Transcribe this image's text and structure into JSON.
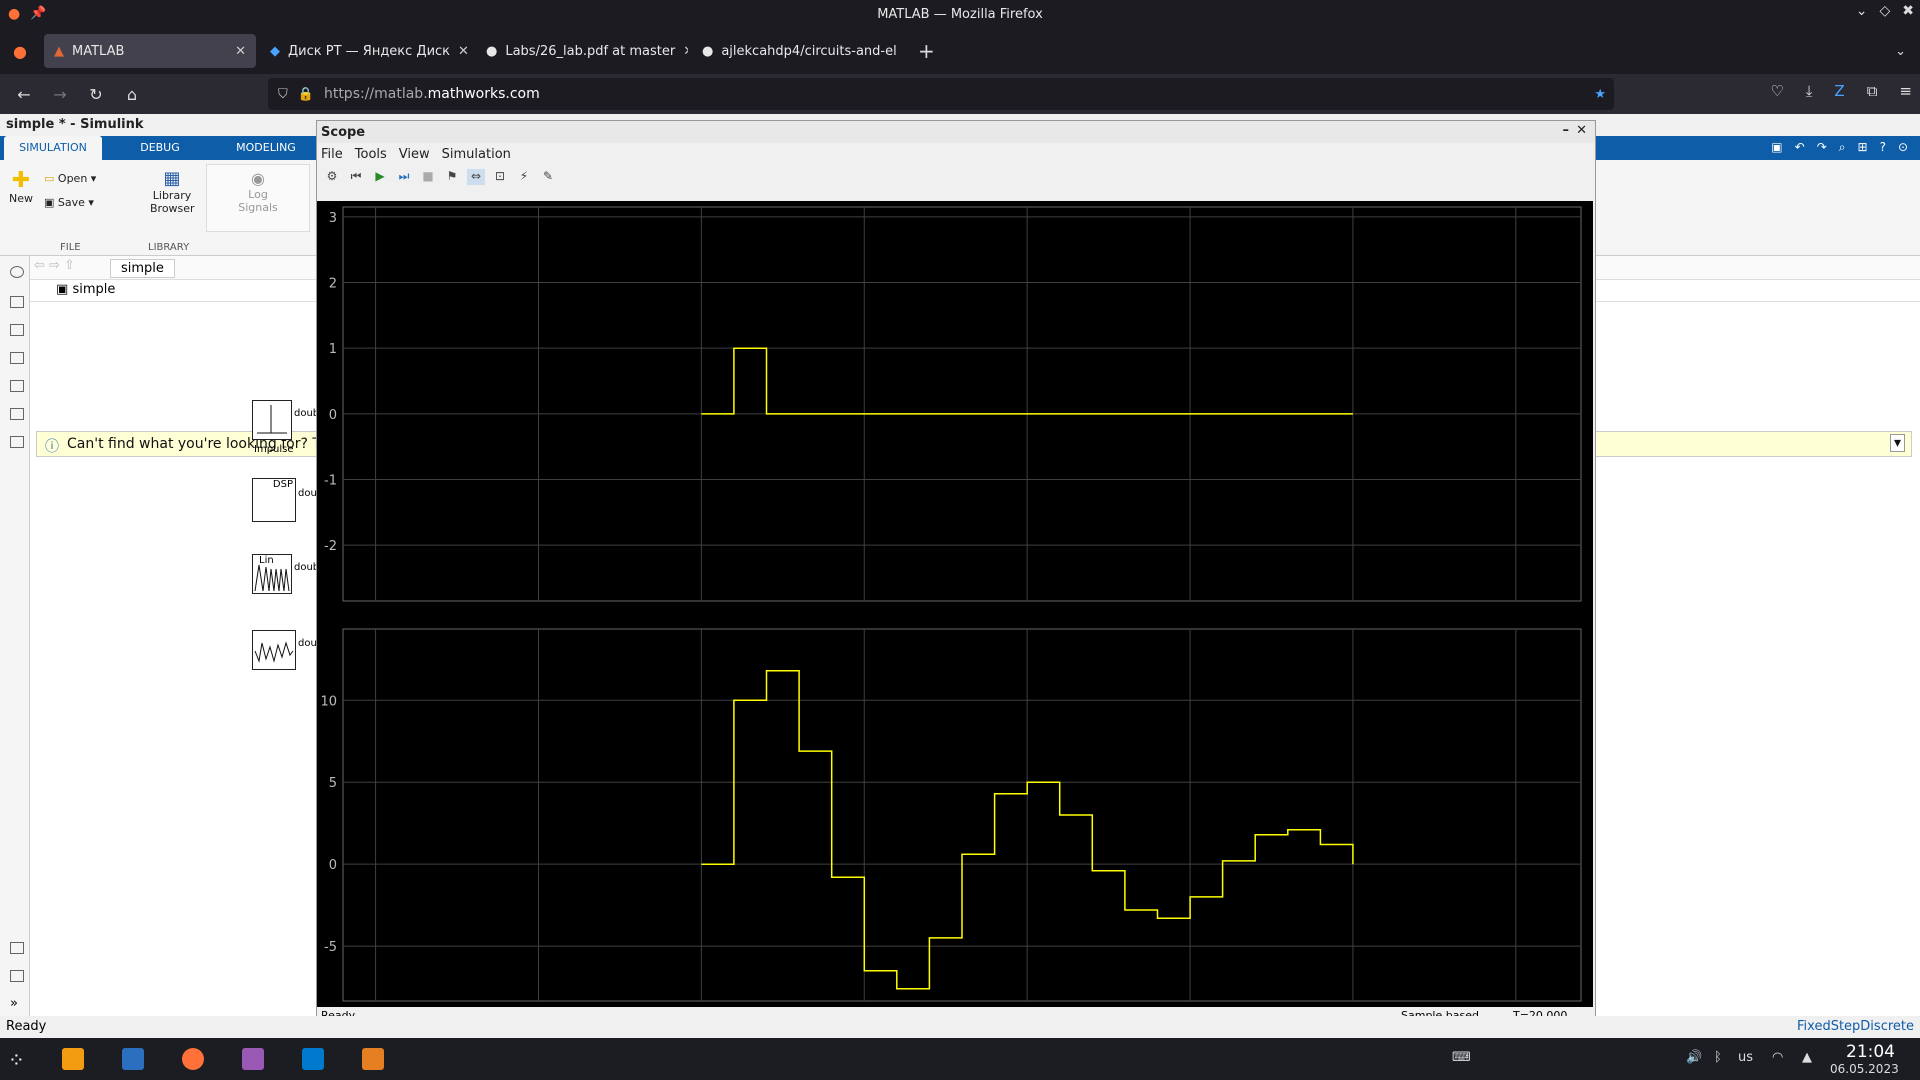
{
  "window": {
    "title": "MATLAB — Mozilla Firefox"
  },
  "tabs": [
    {
      "label": "MATLAB"
    },
    {
      "label": "Диск РТ — Яндекс Диск"
    },
    {
      "label": "Labs/26_lab.pdf at master"
    },
    {
      "label": "ajlekcahdp4/circuits-and-el"
    }
  ],
  "url": {
    "prefix": "https://matlab.",
    "domain": "mathworks.com"
  },
  "simulink": {
    "title": "simple * - Simulink",
    "ribbon_tabs": [
      "SIMULATION",
      "DEBUG",
      "MODELING"
    ],
    "file_group": {
      "new": "New",
      "open": "Open",
      "save": "Save",
      "label": "FILE"
    },
    "library_group": {
      "library_browser_line1": "Library",
      "library_browser_line2": "Browser",
      "label": "LIBRARY"
    },
    "log_signals_line1": "Log",
    "log_signals_line2": "Signals",
    "breadcrumb": "simple",
    "address": "simple",
    "info_bar": "Can't find what you're looking for? T",
    "blocks": [
      {
        "label": "Impulse",
        "port": "doub"
      },
      {
        "label": "DSP",
        "port": "dou"
      },
      {
        "label": "Lin",
        "port": "doub"
      },
      {
        "label": "",
        "port": "dou"
      }
    ],
    "status_left": "Ready",
    "status_right": "FixedStepDiscrete"
  },
  "scope": {
    "title": "Scope",
    "menu": [
      "File",
      "Tools",
      "View",
      "Simulation"
    ],
    "status_left": "Ready",
    "status_mid": "Sample based",
    "status_right": "T=20.000"
  },
  "chart_data": [
    {
      "type": "line",
      "x": [
        0,
        1,
        1,
        2,
        2,
        20
      ],
      "y": [
        0,
        0,
        1,
        1,
        0,
        0
      ],
      "xlim": [
        -11,
        27
      ],
      "ylim": [
        -2.85,
        3.15
      ],
      "yticks": [
        -2,
        -1,
        0,
        1,
        2,
        3
      ],
      "grid": true,
      "color": "#ffff00"
    },
    {
      "type": "line",
      "x": [
        0,
        1,
        1,
        2,
        2,
        3,
        3,
        4,
        4,
        5,
        5,
        6,
        6,
        7,
        7,
        8,
        8,
        9,
        9,
        10,
        10,
        11,
        11,
        12,
        12,
        13,
        13,
        14,
        14,
        15,
        15,
        16,
        16,
        17,
        17,
        18,
        18,
        19,
        19,
        20,
        20
      ],
      "y": [
        0,
        0,
        10,
        10,
        11.8,
        11.8,
        6.9,
        6.9,
        -0.8,
        -0.8,
        -6.5,
        -6.5,
        -7.6,
        -7.6,
        -4.5,
        -4.5,
        0.6,
        0.6,
        4.3,
        4.3,
        5,
        5,
        3,
        3,
        -0.4,
        -0.4,
        -2.8,
        -2.8,
        -3.3,
        -3.3,
        -2,
        -2,
        0.2,
        0.2,
        1.8,
        1.8,
        2.1,
        2.1,
        1.2,
        1.2,
        0
      ],
      "xlim": [
        -11,
        27
      ],
      "ylim": [
        -8.35,
        14.35
      ],
      "yticks": [
        -5,
        0,
        5,
        10
      ],
      "xticks": [
        -10,
        -5,
        0,
        5,
        10,
        15,
        20,
        25
      ],
      "grid": true,
      "color": "#ffff00"
    }
  ],
  "taskbar": {
    "keyboard": "us",
    "time": "21:04",
    "date": "06.05.2023"
  }
}
